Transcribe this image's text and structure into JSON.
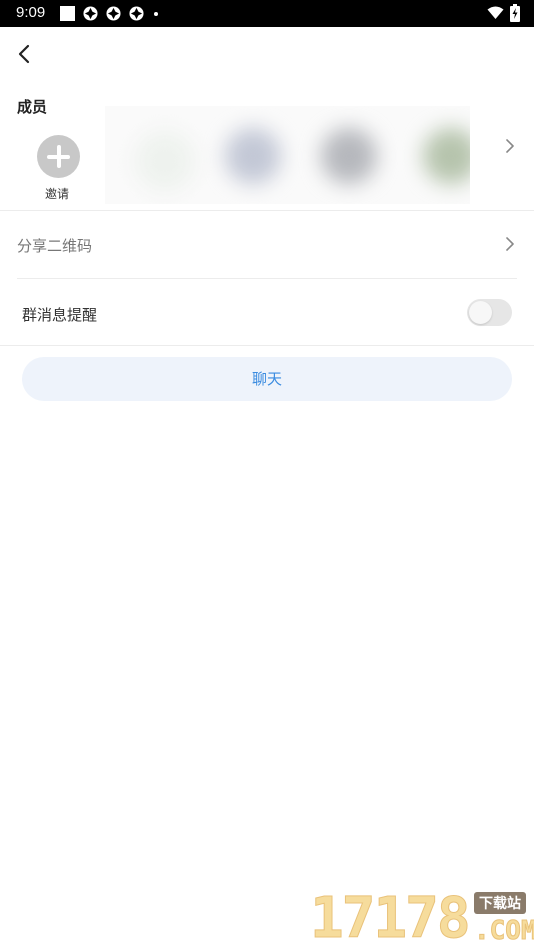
{
  "status_bar": {
    "time": "9:09",
    "icons": [
      "notification-square-icon",
      "app-icon",
      "app-icon",
      "app-icon",
      "dot-icon",
      "wifi-icon",
      "battery-charging-icon"
    ]
  },
  "header": {
    "back_icon": "chevron-left-icon"
  },
  "members": {
    "title": "成员",
    "invite_label": "邀请",
    "invite_icon": "plus-icon",
    "avatar_count": 4,
    "more_icon": "chevron-right-icon"
  },
  "share_qr": {
    "label": "分享二维码",
    "icon": "chevron-right-icon"
  },
  "group_notify": {
    "label": "群消息提醒",
    "enabled": false
  },
  "chat_button": {
    "label": "聊天"
  },
  "colors": {
    "accent": "#3a8be0",
    "button_bg": "#eef3fb",
    "divider": "#ececec"
  },
  "watermark": {
    "number": "17178",
    "tag": "下载站",
    "domain": ".COM"
  }
}
